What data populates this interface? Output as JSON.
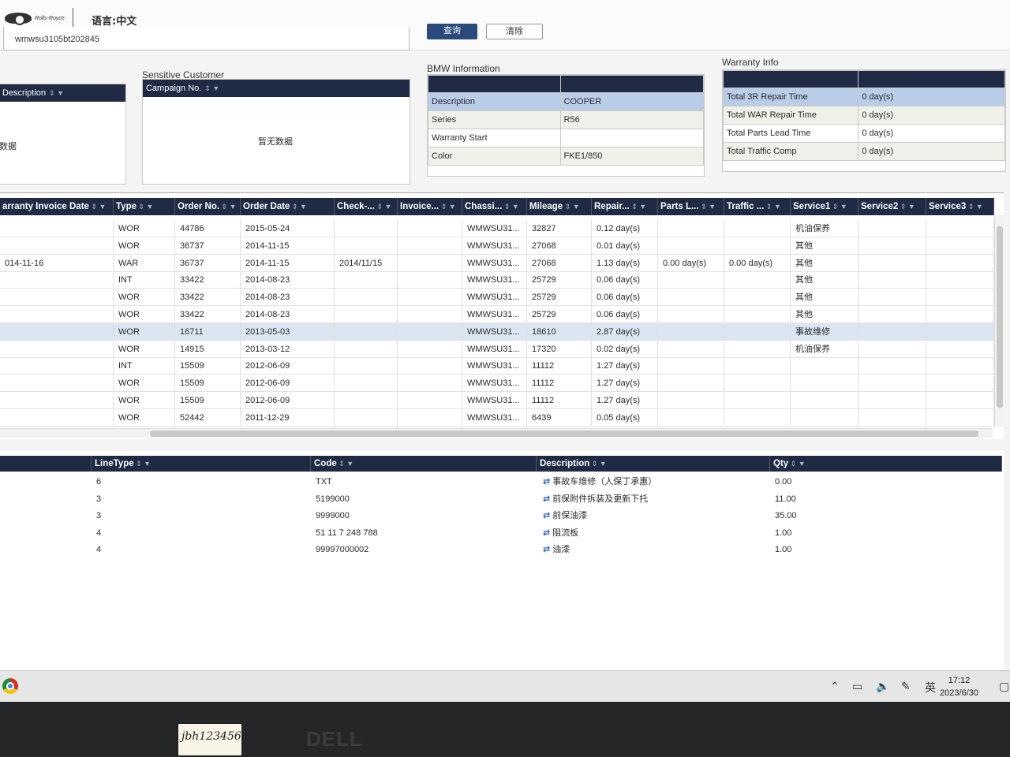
{
  "header": {
    "language": "语言:中文",
    "vin_value": "wmwsu3105bt202845",
    "query_label": "查询",
    "clear_label": "清除"
  },
  "left_panel": {
    "header_label": "Description",
    "empty_text": "数据"
  },
  "sensitive_customer": {
    "title": "Sensitive Customer",
    "header_label": "Campaign No.",
    "empty_text": "暂无数据"
  },
  "bmw_info": {
    "title": "BMW Information",
    "rows": [
      {
        "label": "Description",
        "value": "COOPER"
      },
      {
        "label": "Series",
        "value": "R56"
      },
      {
        "label": "Warranty Start",
        "value": ""
      },
      {
        "label": "Color",
        "value": "FKE1/850"
      }
    ]
  },
  "warranty_info": {
    "title": "Warranty Info",
    "rows": [
      {
        "label": "Total 3R Repair Time",
        "value": "0 day(s)"
      },
      {
        "label": "Total WAR Repair Time",
        "value": "0 day(s)"
      },
      {
        "label": "Total Parts Lead Time",
        "value": "0 day(s)"
      },
      {
        "label": "Total Traffic Comp",
        "value": "0 day(s)"
      }
    ]
  },
  "orders_grid": {
    "columns": [
      "arranty Invoice Date",
      "Type",
      "Order No.",
      "Order Date",
      "Check-...",
      "Invoice...",
      "Chassi...",
      "Mileage",
      "Repair...",
      "Parts L...",
      "Traffic ...",
      "Service1",
      "Service2",
      "Service3"
    ],
    "rows": [
      [
        "",
        "WOR",
        "44786",
        "2015-05-24",
        "",
        "",
        "WMWSU31...",
        "32827",
        "0.12 day(s)",
        "",
        "",
        "机油保养",
        "",
        ""
      ],
      [
        "",
        "WOR",
        "36737",
        "2014-11-15",
        "",
        "",
        "WMWSU31...",
        "27068",
        "0.01 day(s)",
        "",
        "",
        "其他",
        "",
        ""
      ],
      [
        "014-11-16",
        "WAR",
        "36737",
        "2014-11-15",
        "2014/11/15",
        "",
        "WMWSU31...",
        "27068",
        "1.13 day(s)",
        "0.00 day(s)",
        "0.00 day(s)",
        "其他",
        "",
        ""
      ],
      [
        "",
        "INT",
        "33422",
        "2014-08-23",
        "",
        "",
        "WMWSU31...",
        "25729",
        "0.06 day(s)",
        "",
        "",
        "其他",
        "",
        ""
      ],
      [
        "",
        "WOR",
        "33422",
        "2014-08-23",
        "",
        "",
        "WMWSU31...",
        "25729",
        "0.06 day(s)",
        "",
        "",
        "其他",
        "",
        ""
      ],
      [
        "",
        "WOR",
        "33422",
        "2014-08-23",
        "",
        "",
        "WMWSU31...",
        "25729",
        "0.06 day(s)",
        "",
        "",
        "其他",
        "",
        ""
      ],
      [
        "",
        "WOR",
        "16711",
        "2013-05-03",
        "",
        "",
        "WMWSU31...",
        "18610",
        "2.87 day(s)",
        "",
        "",
        "事故维修",
        "",
        ""
      ],
      [
        "",
        "WOR",
        "14915",
        "2013-03-12",
        "",
        "",
        "WMWSU31...",
        "17320",
        "0.02 day(s)",
        "",
        "",
        "机油保养",
        "",
        ""
      ],
      [
        "",
        "INT",
        "15509",
        "2012-06-09",
        "",
        "",
        "WMWSU31...",
        "11112",
        "1.27 day(s)",
        "",
        "",
        "",
        "",
        ""
      ],
      [
        "",
        "WOR",
        "15509",
        "2012-06-09",
        "",
        "",
        "WMWSU31...",
        "11112",
        "1.27 day(s)",
        "",
        "",
        "",
        "",
        ""
      ],
      [
        "",
        "WOR",
        "15509",
        "2012-06-09",
        "",
        "",
        "WMWSU31...",
        "11112",
        "1.27 day(s)",
        "",
        "",
        "",
        "",
        ""
      ],
      [
        "",
        "WOR",
        "52442",
        "2011-12-29",
        "",
        "",
        "WMWSU31...",
        "6439",
        "0.05 day(s)",
        "",
        "",
        "",
        "",
        ""
      ]
    ]
  },
  "line_items": {
    "columns": [
      "LineType",
      "Code",
      "Description",
      "Qty"
    ],
    "rows": [
      [
        "6",
        "TXT",
        "事故车维修（人保丁承惠）",
        "0.00"
      ],
      [
        "3",
        "5199000",
        "前保附件拆装及更新下托",
        "11.00"
      ],
      [
        "3",
        "9999000",
        "前保油漆",
        "35.00"
      ],
      [
        "4",
        "51 11 7 248 788",
        "阻流板",
        "1.00"
      ],
      [
        "4",
        "99997000002",
        "油漆",
        "1.00"
      ]
    ]
  },
  "taskbar": {
    "ime": "英",
    "time": "17:12",
    "date": "2023/6/30"
  },
  "bezel": {
    "note": "jbh123456.",
    "brand": "DELL"
  }
}
